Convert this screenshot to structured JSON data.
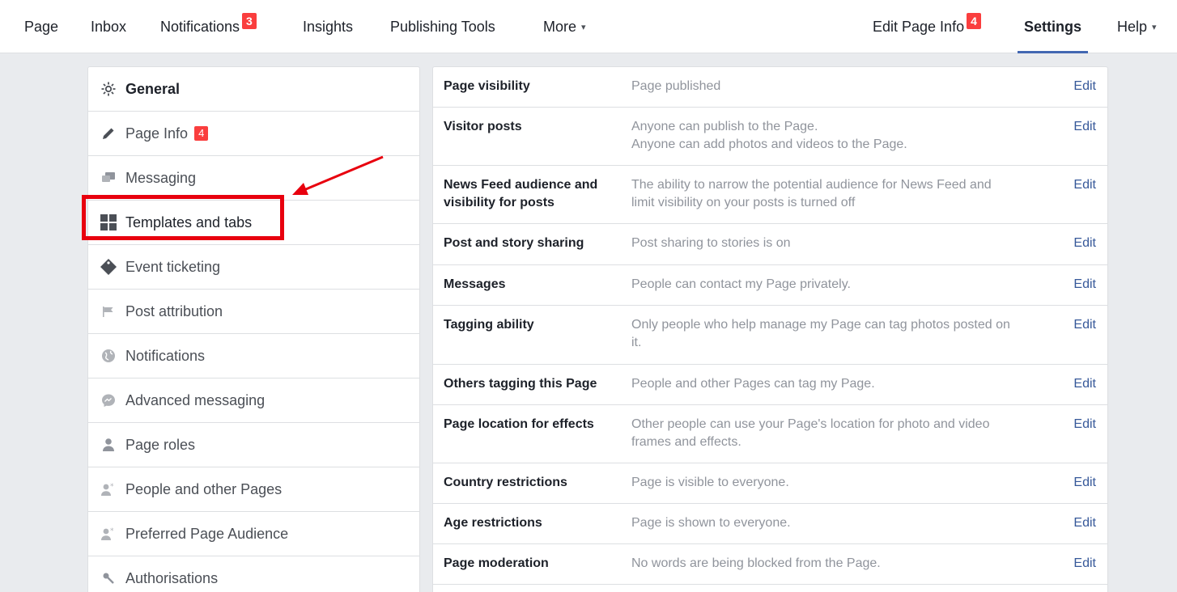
{
  "topnav": {
    "left": [
      {
        "label": "Page"
      },
      {
        "label": "Inbox"
      },
      {
        "label": "Notifications",
        "badge": "3"
      },
      {
        "label": "Insights"
      },
      {
        "label": "Publishing Tools"
      },
      {
        "label": "More",
        "caret": "▾"
      }
    ],
    "right": [
      {
        "label": "Edit Page Info",
        "badge": "4"
      },
      {
        "label": "Settings"
      },
      {
        "label": "Help",
        "caret": "▾"
      }
    ]
  },
  "sidebar": {
    "items": [
      {
        "label": "General",
        "icon": "gear-icon"
      },
      {
        "label": "Page Info",
        "icon": "pencil-icon",
        "badge": "4"
      },
      {
        "label": "Messaging",
        "icon": "chat-bubbles-icon"
      },
      {
        "label": "Templates and tabs",
        "icon": "grid-icon"
      },
      {
        "label": "Event ticketing",
        "icon": "ticket-icon"
      },
      {
        "label": "Post attribution",
        "icon": "flag-icon"
      },
      {
        "label": "Notifications",
        "icon": "globe-icon"
      },
      {
        "label": "Advanced messaging",
        "icon": "messenger-icon"
      },
      {
        "label": "Page roles",
        "icon": "person-icon"
      },
      {
        "label": "People and other Pages",
        "icon": "person-star-icon"
      },
      {
        "label": "Preferred Page Audience",
        "icon": "person-star-icon"
      },
      {
        "label": "Authorisations",
        "icon": "key-icon"
      }
    ]
  },
  "settings": {
    "edit_label": "Edit",
    "rows": [
      {
        "label": "Page visibility",
        "value": "Page published"
      },
      {
        "label": "Visitor posts",
        "value_lines": [
          "Anyone can publish to the Page.",
          "Anyone can add photos and videos to the Page."
        ]
      },
      {
        "label_lines": [
          "News Feed audience and",
          "visibility for posts"
        ],
        "value_lines": [
          "The ability to narrow the potential audience for News Feed and",
          "limit visibility on your posts is turned off"
        ]
      },
      {
        "label": "Post and story sharing",
        "value": "Post sharing to stories is on"
      },
      {
        "label": "Messages",
        "value": "People can contact my Page privately."
      },
      {
        "label": "Tagging ability",
        "value_lines": [
          "Only people who help manage my Page can tag photos posted on",
          "it."
        ]
      },
      {
        "label": "Others tagging this Page",
        "value": "People and other Pages can tag my Page."
      },
      {
        "label": "Page location for effects",
        "value_lines": [
          "Other people can use your Page's location for photo and video",
          "frames and effects."
        ]
      },
      {
        "label": "Country restrictions",
        "value": "Page is visible to everyone."
      },
      {
        "label": "Age restrictions",
        "value": "Page is shown to everyone."
      },
      {
        "label": "Page moderation",
        "value": "No words are being blocked from the Page."
      }
    ]
  },
  "colors": {
    "accent": "#4267b2",
    "link": "#365899",
    "badge": "#fa3e3e",
    "highlight": "#e8000e"
  }
}
